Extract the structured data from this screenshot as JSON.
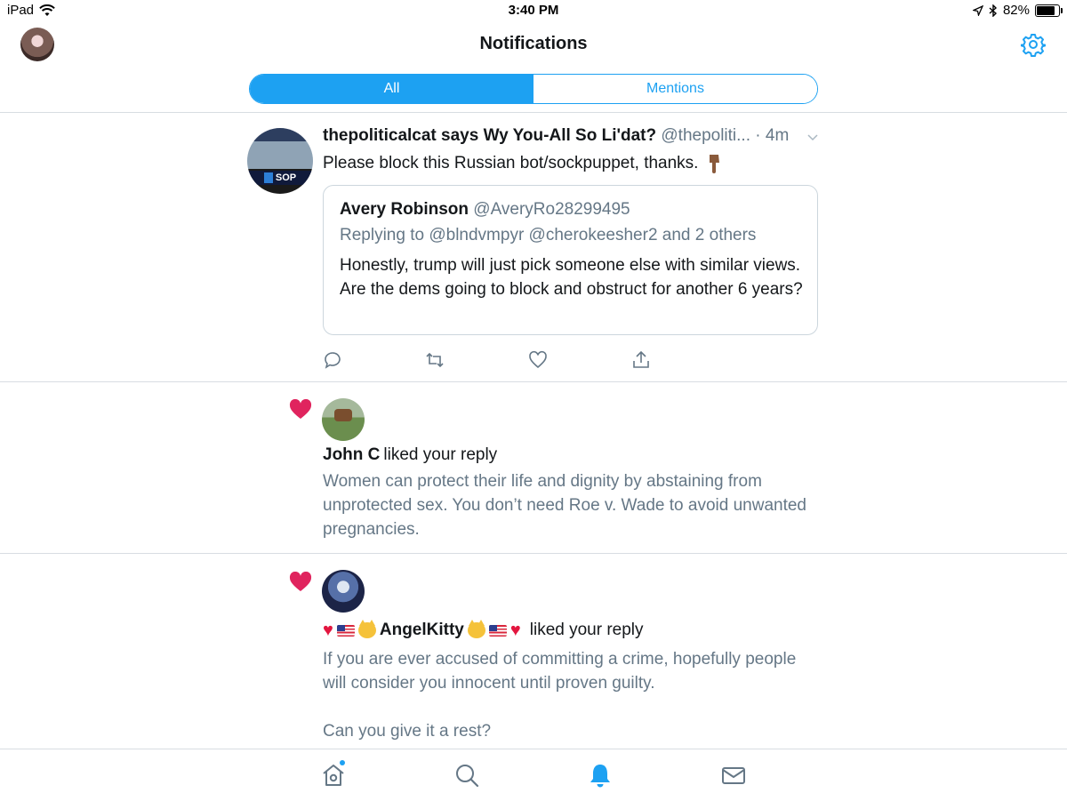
{
  "status_bar": {
    "device": "iPad",
    "time": "3:40 PM",
    "battery": "82%",
    "battery_level": 0.82,
    "icons": [
      "wifi-icon",
      "location-arrow-icon",
      "bluetooth-icon",
      "battery-icon"
    ]
  },
  "header": {
    "title": "Notifications",
    "icons": [
      "profile-avatar",
      "gear-icon"
    ]
  },
  "tabs": [
    {
      "label": "All",
      "active": true
    },
    {
      "label": "Mentions",
      "active": false
    }
  ],
  "tweet": {
    "display_name": "thepoliticalcat says Wy You-All So Li'dat?",
    "handle": "@thepoliti...",
    "time": "· 4m",
    "text": "Please block this Russian bot/sockpuppet, thanks.",
    "emoji": "pointing-down-hand-icon",
    "quote": {
      "name": "Avery Robinson",
      "handle": "@AveryRo28299495",
      "replying": "Replying to @blndvmpyr @cherokeesher2 and 2 others",
      "text": "Honestly, trump will just pick someone else with similar views.  Are the dems going to block and obstruct for another 6 years?"
    },
    "action_icons": [
      "reply-icon",
      "retweet-icon",
      "like-icon",
      "share-icon"
    ]
  },
  "likes": [
    {
      "user": "John C",
      "action": "liked your reply",
      "text": "Women can protect their life and dignity by abstaining from unprotected sex.  You don’t need Roe v. Wade to avoid unwanted pregnancies."
    },
    {
      "user": "AngelKitty",
      "action": "liked your reply",
      "text_line1": "If you are ever accused of committing a crime, hopefully people will consider you innocent until proven guilty.",
      "text_line2": "Can you give it a rest?"
    }
  ],
  "tabbar": {
    "items": [
      "home-icon",
      "search-icon",
      "notifications-bell-icon",
      "messages-icon"
    ],
    "active": "notifications-bell-icon"
  },
  "colors": {
    "accent": "#1da1f2",
    "like_red": "#e0245e",
    "secondary_text": "#657786",
    "divider": "#d8dde2"
  }
}
